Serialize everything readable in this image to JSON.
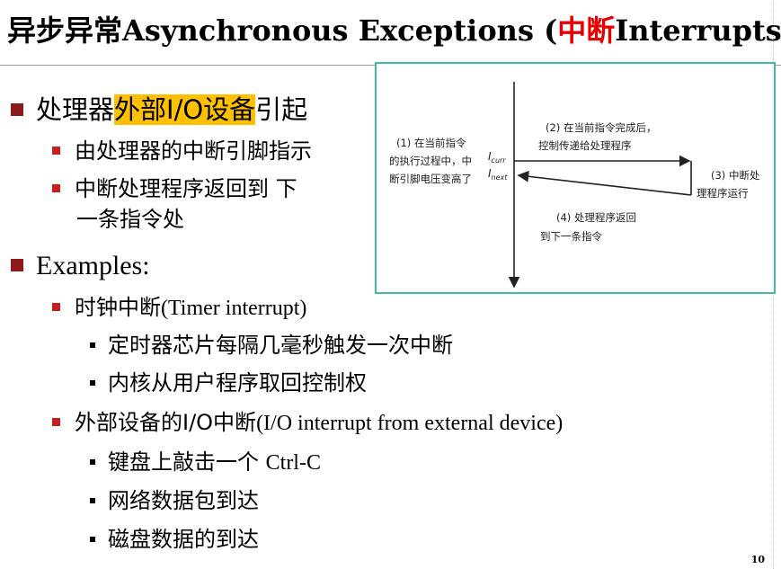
{
  "title": {
    "cn_part": "异步异常",
    "en_part": "Asynchronous Exceptions (",
    "red_part": "中断",
    "en_tail": "Interrupts)"
  },
  "bullets": {
    "b1_prefix": "处理器",
    "b1_highlight": "外部I/O设备",
    "b1_suffix": "引起",
    "b1_sub1": "由处理器的中断引脚指示",
    "b1_sub2_line1": "中断处理程序返回到 下",
    "b1_sub2_line2": "一条指令处",
    "examples_label": "Examples:",
    "ex1_cn": "时钟中断",
    "ex1_en": "(Timer interrupt)",
    "ex1_item1": "定时器芯片每隔几毫秒触发一次中断",
    "ex1_item2": "内核从用户程序取回控制权",
    "ex2_cn": "外部设备的I/O中断",
    "ex2_en": "(I/O interrupt from external device)",
    "ex2_item1_cn": "键盘上敲击一个 ",
    "ex2_item1_en": "Ctrl-C",
    "ex2_item2": "网络数据包到达",
    "ex2_item3": "磁盘数据的到达"
  },
  "diagram": {
    "label1_l1": "(1) 在当前指令",
    "label1_l2": "的执行过程中，中",
    "label1_l3": "断引脚电压变高了",
    "label2_l1": "(2) 在当前指令完成后，",
    "label2_l2": "控制传递给处理程序",
    "label3_l1": "(3) 中断处",
    "label3_l2": "理程序运行",
    "label4_l1": "(4) 处理程序返回",
    "label4_l2": "到下一条指令",
    "icurr_base": "I",
    "icurr_sub": "curr",
    "inext_base": "I",
    "inext_sub": "next"
  },
  "page_number": "10"
}
